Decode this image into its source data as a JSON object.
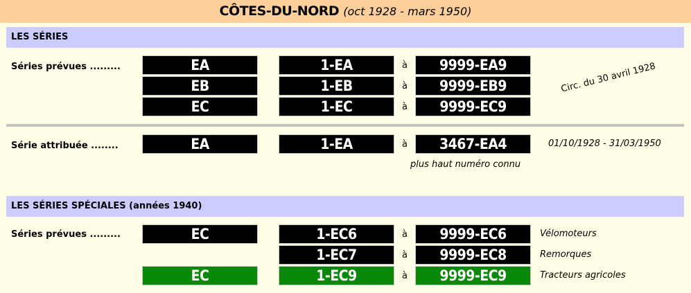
{
  "header": {
    "title": "CÔTES-DU-NORD",
    "subtitle": "(oct 1928 - mars 1950)"
  },
  "section_series": {
    "heading": "LES SÉRIES",
    "planned_label": "Séries prévues .........",
    "planned_rows": [
      {
        "series": "EA",
        "from": "1-EA",
        "sep": "à",
        "to": "9999-EA9"
      },
      {
        "series": "EB",
        "from": "1-EB",
        "sep": "à",
        "to": "9999-EB9"
      },
      {
        "series": "EC",
        "from": "1-EC",
        "sep": "à",
        "to": "9999-EC9"
      }
    ],
    "circular_note": "Circ. du 30 avril 1928",
    "assigned_label": "Série attribuée ........",
    "assigned": {
      "series": "EA",
      "from": "1-EA",
      "sep": "à",
      "to": "3467-EA4"
    },
    "assigned_dates": "01/10/1928 - 31/03/1950",
    "highest_note": "plus haut numéro connu"
  },
  "section_special": {
    "heading": "LES SÉRIES SPÉCIALES (années 1940)",
    "planned_label": "Séries prévues .........",
    "rows": [
      {
        "series": "EC",
        "from": "1-EC6",
        "sep": "à",
        "to": "9999-EC6",
        "use": "Vélomoteurs"
      },
      {
        "series": "",
        "from": "1-EC7",
        "sep": "à",
        "to": "9999-EC8",
        "use": "Remorques"
      },
      {
        "series": "EC",
        "from": "1-EC9",
        "sep": "à",
        "to": "9999-EC9",
        "use": "Tracteurs agricoles"
      }
    ]
  },
  "colors": {
    "title_bar": "#FDCF9A",
    "section_header": "#CCCCFF",
    "background": "#FFFFE8",
    "plate_black": "#000000",
    "plate_green": "#0A880A"
  }
}
